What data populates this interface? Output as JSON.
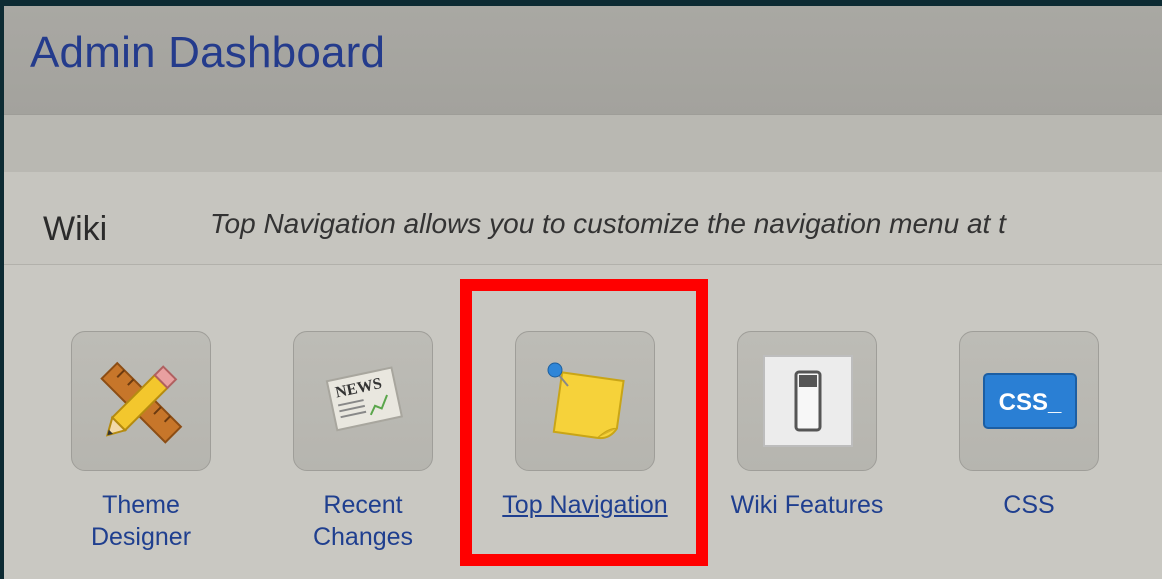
{
  "page": {
    "title": "Admin Dashboard"
  },
  "wiki": {
    "label": "Wiki",
    "description": "Top Navigation allows you to customize the navigation menu at t"
  },
  "tools": [
    {
      "label_line1": "Theme",
      "label_line2": "Designer",
      "icon": "pencil-ruler-icon"
    },
    {
      "label_line1": "Recent",
      "label_line2": "Changes",
      "icon": "newspaper-icon"
    },
    {
      "label_line1": "Top Navigation",
      "label_line2": "",
      "icon": "sticky-note-icon"
    },
    {
      "label_line1": "Wiki Features",
      "label_line2": "",
      "icon": "toggle-switch-icon"
    },
    {
      "label_line1": "CSS",
      "label_line2": "",
      "icon": "css-icon",
      "badge": "CSS_"
    }
  ],
  "colors": {
    "title": "#243b8c",
    "link": "#1f3f8f",
    "highlight": "#ff0000"
  }
}
